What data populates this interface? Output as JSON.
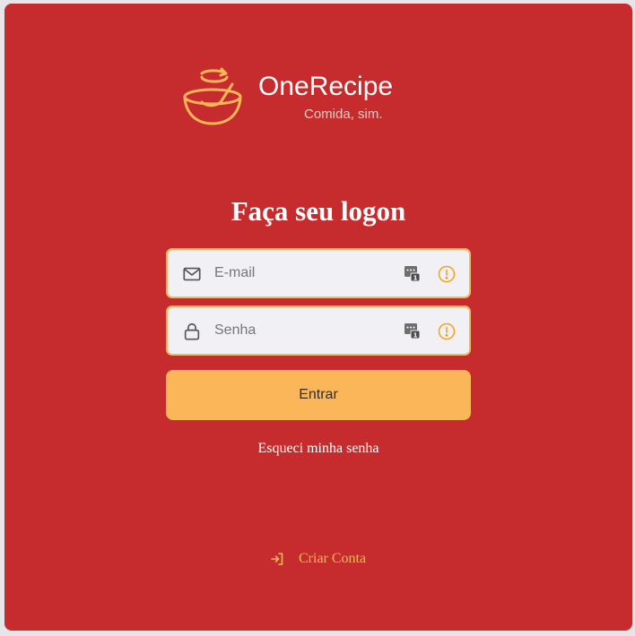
{
  "brand": {
    "name": "OneRecipe",
    "tagline": "Comida, sim.",
    "logo_icon": "bowl-whisk-icon"
  },
  "login": {
    "heading": "Faça seu logon",
    "email": {
      "placeholder": "E-mail",
      "value": "",
      "icon": "mail-icon"
    },
    "password": {
      "placeholder": "Senha",
      "value": "",
      "icon": "lock-icon"
    },
    "submit_label": "Entrar",
    "forgot_label": "Esqueci minha senha",
    "signup_label": "Criar Conta"
  },
  "colors": {
    "background": "#c62b2d",
    "accent": "#fbb65a",
    "field_bg": "#f0f0f5",
    "text_light": "#ffffff"
  }
}
